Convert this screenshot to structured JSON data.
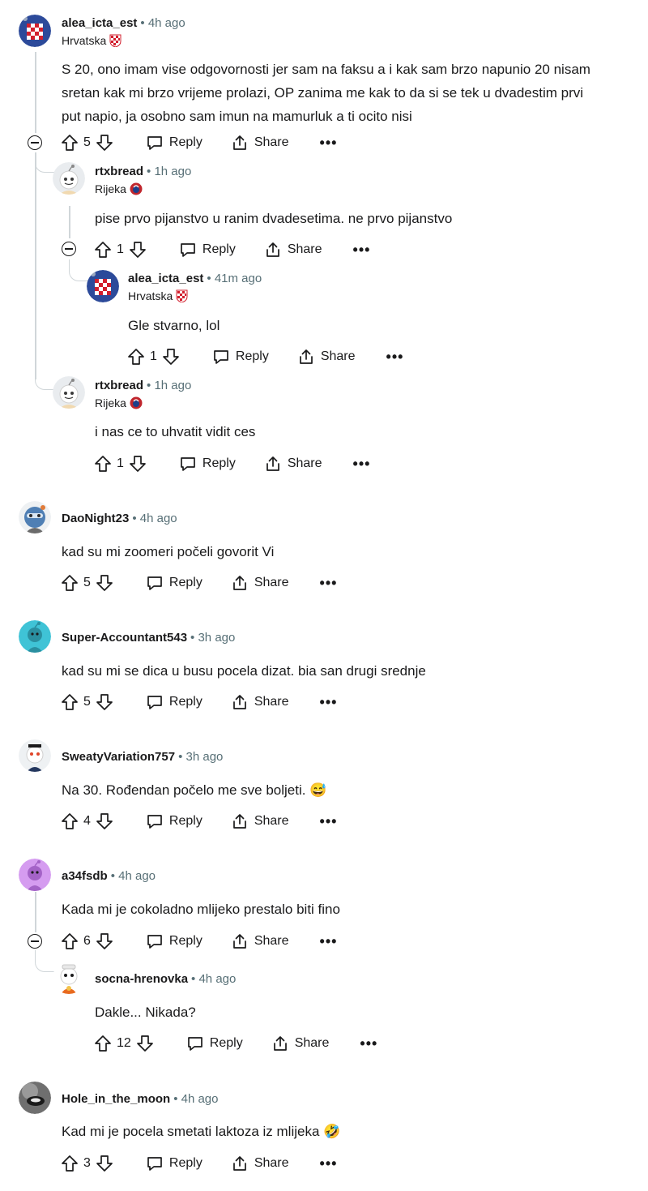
{
  "labels": {
    "reply": "Reply",
    "share": "Share",
    "more": "•••"
  },
  "comments": [
    {
      "user": "alea_icta_est",
      "time": "• 4h ago",
      "flair": "Hrvatska",
      "lines": [
        "S 20, ono imam vise odgovornosti jer sam na faksu a i kak sam brzo napunio 20 nisam",
        "sretan kak mi brzo vrijeme prolazi, OP zanima me kak to da si se tek u dvadestim prvi",
        "put napio, ja osobno sam imun na mamurluk a ti ocito nisi"
      ],
      "votes": "5"
    },
    {
      "user": "rtxbread",
      "time": "• 1h ago",
      "flair": "Rijeka",
      "lines": [
        "pise prvo pijanstvo u ranim dvadesetima. ne prvo pijanstvo"
      ],
      "votes": "1"
    },
    {
      "user": "alea_icta_est",
      "time": "• 41m ago",
      "flair": "Hrvatska",
      "lines": [
        "Gle stvarno, lol"
      ],
      "votes": "1"
    },
    {
      "user": "rtxbread",
      "time": "• 1h ago",
      "flair": "Rijeka",
      "lines": [
        "i nas ce to uhvatit vidit ces"
      ],
      "votes": "1"
    },
    {
      "user": "DaoNight23",
      "time": "• 4h ago",
      "lines": [
        "kad su mi zoomeri počeli govorit Vi"
      ],
      "votes": "5"
    },
    {
      "user": "Super-Accountant543",
      "time": "• 3h ago",
      "lines": [
        "kad su mi se dica u busu pocela dizat. bia san drugi srednje"
      ],
      "votes": "5"
    },
    {
      "user": "SweatyVariation757",
      "time": "• 3h ago",
      "lines": [
        "Na 30. Rođendan počelo me sve boljeti. 😅"
      ],
      "votes": "4"
    },
    {
      "user": "a34fsdb",
      "time": "• 4h ago",
      "lines": [
        "Kada mi je cokoladno mlijeko prestalo biti fino"
      ],
      "votes": "6"
    },
    {
      "user": "socna-hrenovka",
      "time": "• 4h ago",
      "lines": [
        "Dakle... Nikada?"
      ],
      "votes": "12"
    },
    {
      "user": "Hole_in_the_moon",
      "time": "• 4h ago",
      "lines": [
        "Kad mi je pocela smetati laktoza iz mlijeka 🤣"
      ],
      "votes": "3"
    }
  ]
}
